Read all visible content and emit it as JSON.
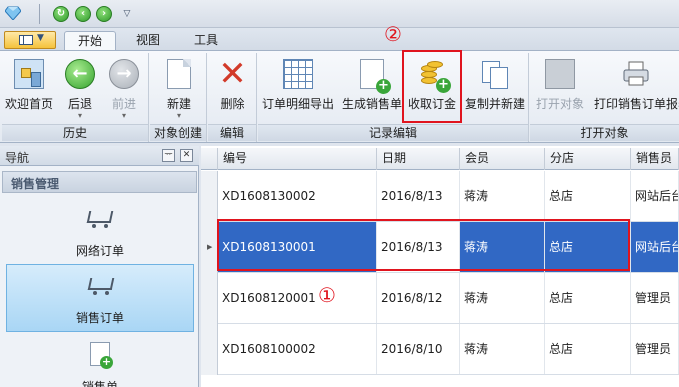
{
  "quick_access": {
    "icons": [
      "app-gem-icon",
      "refresh-icon",
      "back-icon",
      "forward-icon",
      "customize-dropdown-icon"
    ]
  },
  "ribbon_tabs": [
    {
      "label": "开始",
      "active": true
    },
    {
      "label": "视图",
      "active": false
    },
    {
      "label": "工具",
      "active": false
    }
  ],
  "ribbon": {
    "groups": [
      {
        "label": "历史",
        "buttons": [
          {
            "label": "欢迎首页",
            "icon": "home-icon"
          },
          {
            "label": "后退",
            "icon": "back-arrow-icon",
            "sub": "▾"
          },
          {
            "label": "前进",
            "icon": "forward-arrow-icon",
            "sub": "▾",
            "disabled": true
          }
        ]
      },
      {
        "label": "对象创建",
        "buttons": [
          {
            "label": "新建",
            "icon": "new-page-icon",
            "sub": "▾"
          }
        ]
      },
      {
        "label": "编辑",
        "buttons": [
          {
            "label": "删除",
            "icon": "delete-x-icon"
          }
        ]
      },
      {
        "label": "记录编辑",
        "buttons": [
          {
            "label": "订单明细导出",
            "icon": "grid-export-icon"
          },
          {
            "label": "生成销售单",
            "icon": "document-plus-icon"
          },
          {
            "label": "收取订金",
            "icon": "coins-plus-icon"
          },
          {
            "label": "复制并新建",
            "icon": "copy-icon"
          }
        ]
      },
      {
        "label": "打开对象",
        "buttons": [
          {
            "label": "打开对象",
            "icon": "open-object-icon",
            "disabled": true
          },
          {
            "label": "打印销售订单报表",
            "icon": "printer-icon"
          }
        ]
      }
    ]
  },
  "annotations": {
    "marker_1": "①",
    "marker_2": "②",
    "color": "#e0141e"
  },
  "nav": {
    "title": "导航",
    "pin_glyph": "ᅲ",
    "close_glyph": "✕",
    "section": "销售管理",
    "items": [
      {
        "label": "网络订单",
        "icon": "cart-icon",
        "selected": false
      },
      {
        "label": "销售订单",
        "icon": "cart-plus-icon",
        "selected": true
      },
      {
        "label": "销售单",
        "icon": "bill-icon",
        "selected": false
      }
    ]
  },
  "grid": {
    "columns": [
      "编号",
      "日期",
      "会员",
      "分店",
      "销售员"
    ],
    "rows": [
      {
        "id": "XD1608130002",
        "date": "2016/8/13",
        "member": "蒋涛",
        "branch": "总店",
        "seller": "网站后台"
      },
      {
        "id": "XD1608130001",
        "date": "2016/8/13",
        "member": "蒋涛",
        "branch": "总店",
        "seller": "网站后台",
        "selected": true
      },
      {
        "id": "XD1608120001",
        "date": "2016/8/12",
        "member": "蒋涛",
        "branch": "总店",
        "seller": "管理员"
      },
      {
        "id": "XD1608100002",
        "date": "2016/8/10",
        "member": "蒋涛",
        "branch": "总店",
        "seller": "管理员"
      }
    ]
  },
  "colors": {
    "selection": "#3168c4",
    "accent_red": "#e0141e",
    "ribbon_border": "#a3b2c6"
  }
}
